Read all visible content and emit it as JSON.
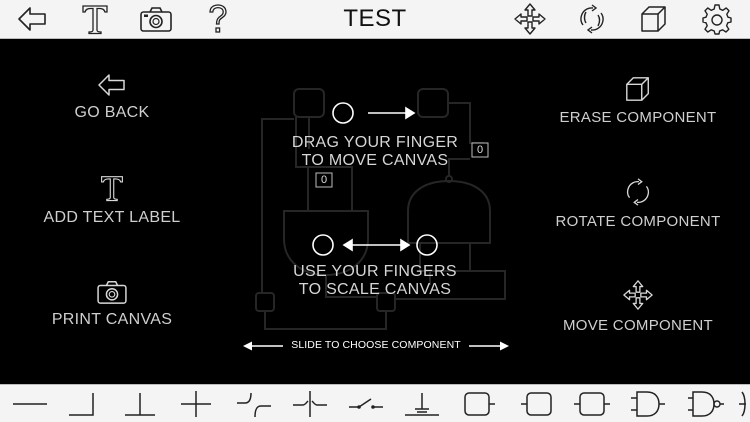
{
  "toolbar": {
    "title": "TEST",
    "left_icons": [
      "back-arrow-icon",
      "text-label-icon",
      "camera-icon",
      "help-question-icon"
    ],
    "right_icons": [
      "move-arrows-icon",
      "rotate-icon",
      "cube-icon",
      "gear-icon"
    ]
  },
  "help": {
    "go_back": "GO BACK",
    "add_text_label": "ADD TEXT LABEL",
    "print_canvas": "PRINT CANVAS",
    "erase_component": "ERASE COMPONENT",
    "rotate_component": "ROTATE COMPONENT",
    "move_component": "MOVE COMPONENT",
    "drag_line1": "DRAG YOUR FINGER",
    "drag_line2": "TO MOVE CANVAS",
    "scale_line1": "USE YOUR FINGERS",
    "scale_line2": "TO SCALE CANVAS",
    "slide_hint": "SLIDE TO CHOOSE COMPONENT"
  },
  "canvas_values": {
    "input_a": "0",
    "input_b": "0"
  },
  "components": [
    "wire-straight",
    "wire-corner",
    "wire-tee",
    "wire-cross",
    "wire-bridge-curve",
    "wire-bridge-junction",
    "switch",
    "ground-switch",
    "input-box",
    "output-box",
    "node-box",
    "and-gate",
    "nand-gate"
  ],
  "colors": {
    "bar_bg": "#f4f4f4",
    "canvas_bg": "#000000",
    "help_text": "#cfcfcf",
    "icon_stroke": "#222222"
  }
}
